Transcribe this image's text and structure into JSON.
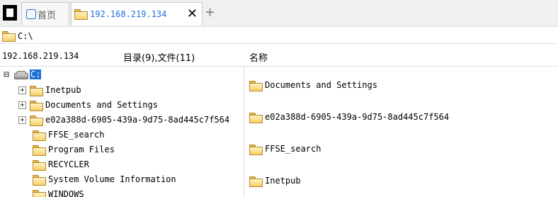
{
  "tabs": {
    "home_label": "首页",
    "active_label": "192.168.219.134",
    "close_glyph": "✕",
    "add_glyph": "+"
  },
  "path": {
    "value": "C:\\"
  },
  "header": {
    "host": "192.168.219.134",
    "counts": "目录(9),文件(11)",
    "name_col": "名称"
  },
  "tree": {
    "root": {
      "expander": "⊟",
      "label": "C:"
    },
    "items": [
      {
        "expander": "+",
        "label": "Inetpub"
      },
      {
        "expander": "+",
        "label": "Documents and Settings"
      },
      {
        "expander": "+",
        "label": "e02a388d-6905-439a-9d75-8ad445c7f564"
      },
      {
        "expander": "",
        "label": "FFSE_search"
      },
      {
        "expander": "",
        "label": "Program Files"
      },
      {
        "expander": "",
        "label": "RECYCLER"
      },
      {
        "expander": "",
        "label": "System Volume Information"
      },
      {
        "expander": "",
        "label": "WINDOWS"
      }
    ]
  },
  "list": {
    "items": [
      {
        "label": "Documents and Settings"
      },
      {
        "label": "e02a388d-6905-439a-9d75-8ad445c7f564"
      },
      {
        "label": "FFSE_search"
      },
      {
        "label": "Inetpub"
      }
    ]
  },
  "colors": {
    "accent": "#1b6fd8",
    "selection": "#1c71d8",
    "folder": "#f6cf6a"
  },
  "icons": {
    "app": "app-logo-icon",
    "home": "home-icon",
    "folder": "folder-icon",
    "drive": "drive-icon"
  }
}
